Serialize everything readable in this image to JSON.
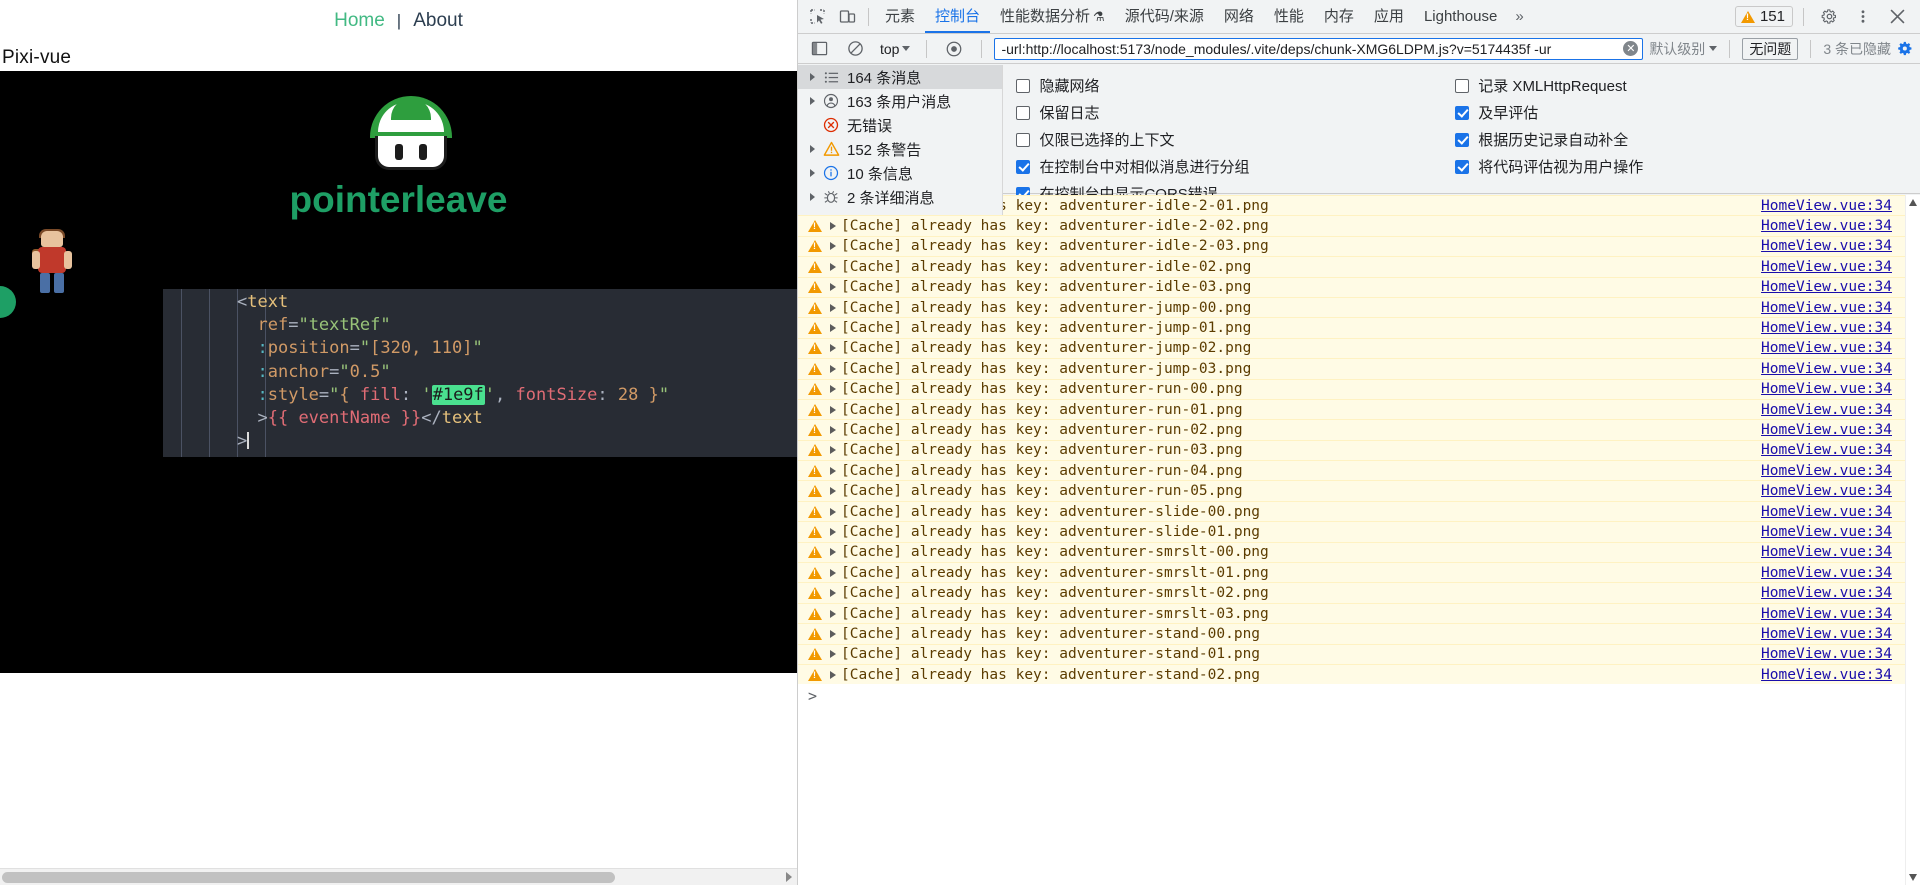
{
  "app": {
    "nav": {
      "home": "Home",
      "separator": "|",
      "about": "About"
    },
    "title": "Pixi-vue",
    "canvas": {
      "sprite_label": "pointerleave",
      "sprite_label_color": "#1e9f65",
      "mushroom_icon": "mushroom-sprite",
      "adventurer_icon": "adventurer-sprite"
    },
    "code": {
      "lines": [
        "<text",
        "  ref=\"textRef\"",
        "  :position=\"[320, 110]\"",
        "  :anchor=\"0.5\"",
        "  :style=\"{ fill: '#1e9f', fontSize: 28 }\"",
        "  >{{ eventName }}</text",
        ">"
      ],
      "highlighted_color": "#1e9f",
      "tag": "text",
      "ref_value": "textRef",
      "position_value": "[320, 110]",
      "anchor_value": "0.5",
      "font_size": "28",
      "interpolation": "{{ eventName }}"
    }
  },
  "devtools": {
    "tabs": [
      {
        "label": "元素",
        "active": false
      },
      {
        "label": "控制台",
        "active": true
      },
      {
        "label": "性能数据分析",
        "active": false,
        "suffix": "⚗"
      },
      {
        "label": "源代码/来源",
        "active": false
      },
      {
        "label": "网络",
        "active": false
      },
      {
        "label": "性能",
        "active": false
      },
      {
        "label": "内存",
        "active": false
      },
      {
        "label": "应用",
        "active": false
      },
      {
        "label": "Lighthouse",
        "active": false
      }
    ],
    "more_tabs": "»",
    "warning_badge_count": "151",
    "icons": {
      "inspect": "inspect-element-icon",
      "device": "device-toolbar-icon",
      "settings": "gear-icon",
      "more": "kebab-menu-icon",
      "close": "close-icon"
    },
    "filterbar": {
      "sidebar_toggle": "sidebar-toggle-icon",
      "clear_console": "clear-console-icon",
      "context_label": "top",
      "eye_icon": "live-expression-icon",
      "filter_value": "-url:http://localhost:5173/node_modules/.vite/deps/chunk-XMG6LDPM.js?v=5174435f -ur",
      "clear_filter": "clear-filter-icon",
      "level_label": "默认级别",
      "issues_label": "无问题",
      "hidden_label": "3 条已隐藏",
      "settings_gear": "console-settings-gear-icon"
    },
    "sidebar": [
      {
        "label": "164 条消息",
        "icon": "list-icon",
        "expandable": true,
        "selected": true
      },
      {
        "label": "163 条用户消息",
        "icon": "user-icon",
        "expandable": true,
        "selected": false
      },
      {
        "label": "无错误",
        "icon": "error-icon",
        "expandable": false,
        "selected": false
      },
      {
        "label": "152 条警告",
        "icon": "warning-icon",
        "expandable": true,
        "selected": false
      },
      {
        "label": "10 条信息",
        "icon": "info-icon",
        "expandable": true,
        "selected": false
      },
      {
        "label": "2 条详细消息",
        "icon": "verbose-bug-icon",
        "expandable": true,
        "selected": false
      }
    ],
    "settings": {
      "left": [
        {
          "label": "隐藏网络",
          "checked": false
        },
        {
          "label": "保留日志",
          "checked": false
        },
        {
          "label": "仅限已选择的上下文",
          "checked": false
        },
        {
          "label": "在控制台中对相似消息进行分组",
          "checked": true
        },
        {
          "label": "在控制台中显示CORS错误",
          "checked": true
        }
      ],
      "right": [
        {
          "label": "记录 XMLHttpRequest",
          "checked": false
        },
        {
          "label": "及早评估",
          "checked": true
        },
        {
          "label": "根据历史记录自动补全",
          "checked": true
        },
        {
          "label": "将代码评估视为用户操作",
          "checked": true
        }
      ]
    },
    "log": {
      "prefix": "[Cache] already has key: ",
      "source": "HomeView.vue:34",
      "prompt": ">",
      "rows": [
        "adventurer-idle-2-01.png",
        "adventurer-idle-2-02.png",
        "adventurer-idle-2-03.png",
        "adventurer-idle-02.png",
        "adventurer-idle-03.png",
        "adventurer-jump-00.png",
        "adventurer-jump-01.png",
        "adventurer-jump-02.png",
        "adventurer-jump-03.png",
        "adventurer-run-00.png",
        "adventurer-run-01.png",
        "adventurer-run-02.png",
        "adventurer-run-03.png",
        "adventurer-run-04.png",
        "adventurer-run-05.png",
        "adventurer-slide-00.png",
        "adventurer-slide-01.png",
        "adventurer-smrslt-00.png",
        "adventurer-smrslt-01.png",
        "adventurer-smrslt-02.png",
        "adventurer-smrslt-03.png",
        "adventurer-stand-00.png",
        "adventurer-stand-01.png",
        "adventurer-stand-02.png"
      ]
    }
  }
}
